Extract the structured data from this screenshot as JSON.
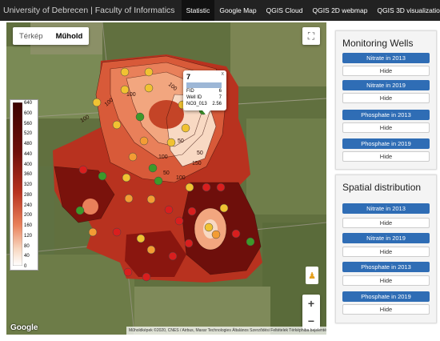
{
  "nav": {
    "brand": "University of Debrecen | Faculty of Informatics",
    "items": [
      "Statistic",
      "Google Map",
      "QGIS Cloud",
      "QGIS 2D webmap",
      "QGIS 3D visualization"
    ]
  },
  "map": {
    "type_buttons": [
      "Térkép",
      "Műhold"
    ],
    "active_type": "Műhold",
    "google_label": "Google",
    "attribution": "Műholdképek ©2020, CNES / Airbus, Maxar Technologies   Általános Szerződési Feltételek   Térképhiba bejelentése",
    "zoom_in": "+",
    "zoom_out": "−",
    "fullscreen_icon": "fullscreen-icon",
    "legend_ticks": [
      "640",
      "600",
      "560",
      "520",
      "480",
      "440",
      "400",
      "360",
      "320",
      "280",
      "240",
      "200",
      "160",
      "120",
      "80",
      "40",
      "0"
    ],
    "contour_labels": [
      "100",
      "100",
      "100",
      "100",
      "50",
      "50",
      "50",
      "100",
      "150",
      "100"
    ],
    "popup": {
      "title": "7",
      "close": "x",
      "rows": [
        {
          "k": "",
          "v": ""
        },
        {
          "k": "FID",
          "v": "6"
        },
        {
          "k": "Well ID",
          "v": "7"
        },
        {
          "k": "NO3_013",
          "v": "2.56"
        }
      ]
    }
  },
  "monitoring": {
    "title": "Monitoring Wells",
    "layers": [
      {
        "label": "Nitrate in 2013",
        "hide": "Hide"
      },
      {
        "label": "Nitrate in 2019",
        "hide": "Hide"
      },
      {
        "label": "Phosphate in 2013",
        "hide": "Hide"
      },
      {
        "label": "Phosphate in 2019",
        "hide": "Hide"
      }
    ]
  },
  "spatial": {
    "title": "Spatial distribution",
    "layers": [
      {
        "label": "Nitrate in 2013",
        "hide": "Hide"
      },
      {
        "label": "Nitrate in 2019",
        "hide": "Hide"
      },
      {
        "label": "Phosphate in 2013",
        "hide": "Hide"
      },
      {
        "label": "Phosphate in 2019",
        "hide": "Hide"
      }
    ]
  },
  "colors": {
    "nav_bg": "#222222",
    "button_blue": "#2f6db5",
    "well_red": "#d91e1e",
    "well_yellow": "#f1c232",
    "well_orange": "#f39c34",
    "well_green": "#3d9a2a"
  }
}
